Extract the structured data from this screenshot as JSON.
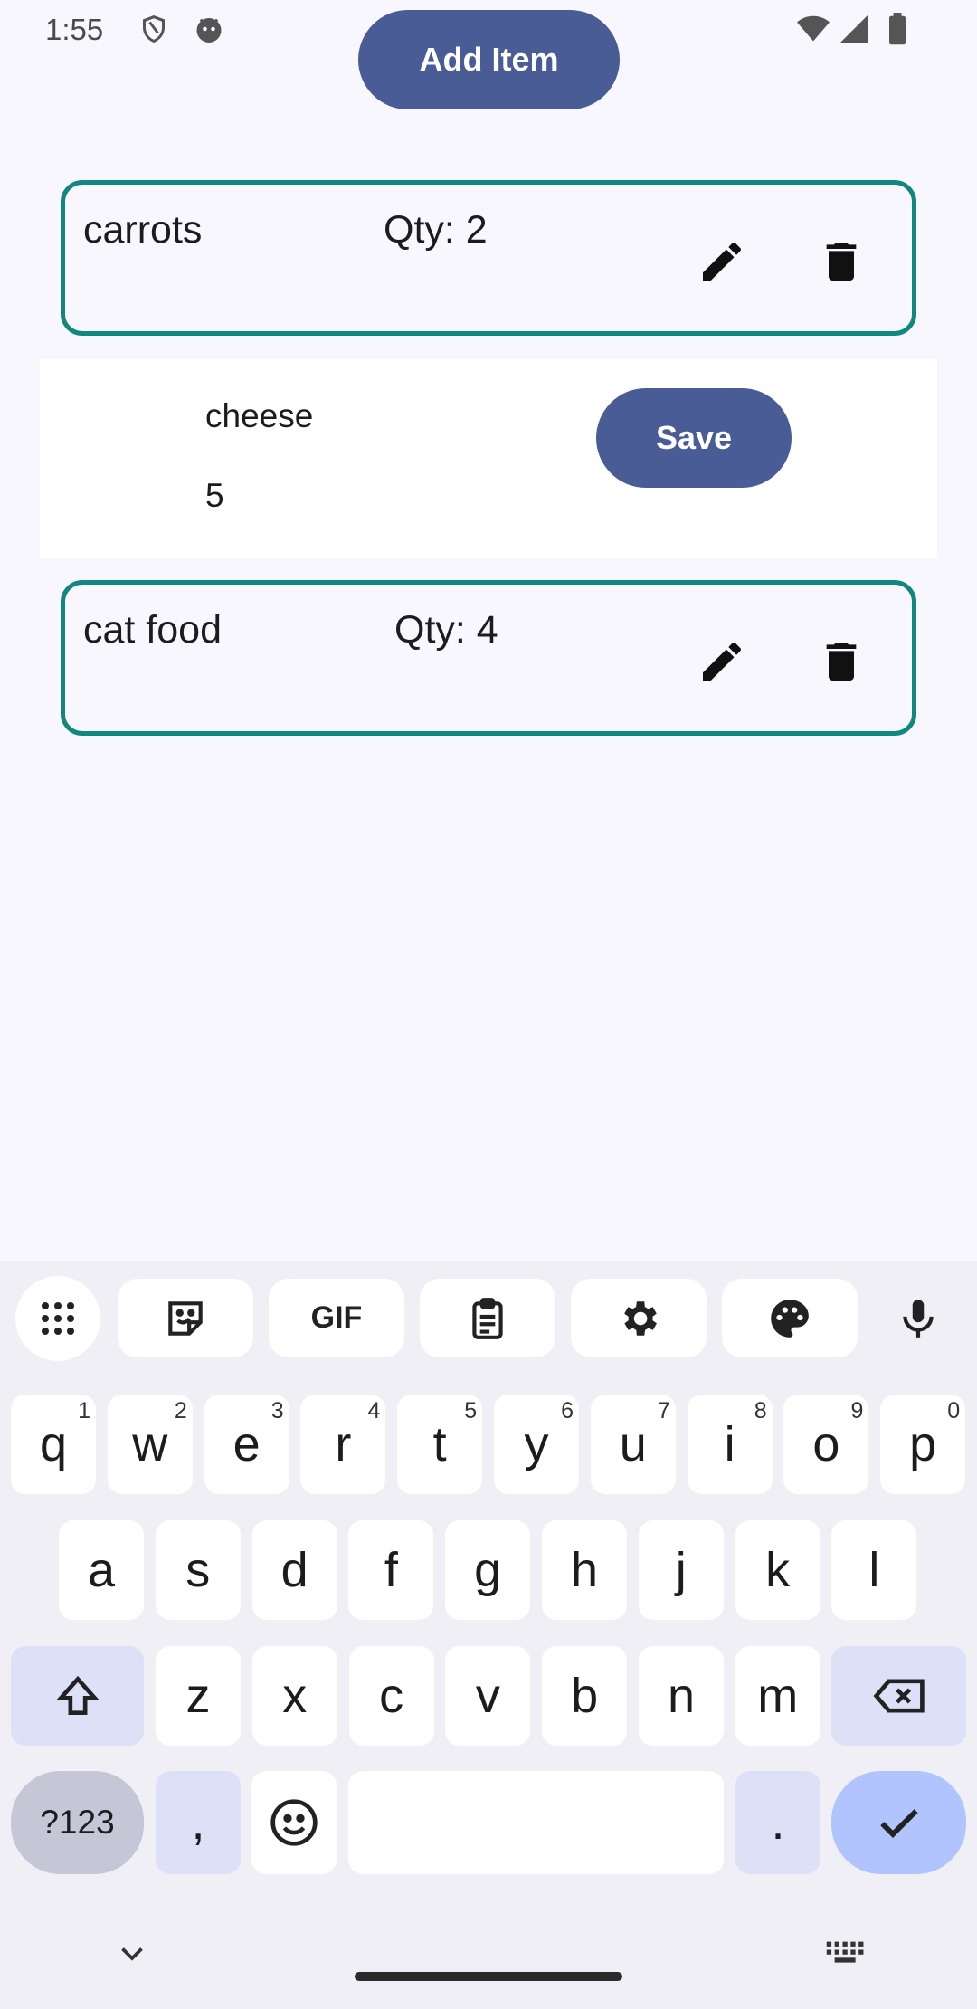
{
  "status": {
    "time": "1:55"
  },
  "header": {
    "add_label": "Add Item"
  },
  "items": [
    {
      "name": "carrots",
      "qty": "Qty: 2"
    },
    {
      "name": "cat food",
      "qty": "Qty: 4"
    }
  ],
  "edit": {
    "name_value": "cheese",
    "qty_value": "5",
    "save_label": "Save"
  },
  "keyboard": {
    "row1": [
      {
        "k": "q",
        "h": "1"
      },
      {
        "k": "w",
        "h": "2"
      },
      {
        "k": "e",
        "h": "3"
      },
      {
        "k": "r",
        "h": "4"
      },
      {
        "k": "t",
        "h": "5"
      },
      {
        "k": "y",
        "h": "6"
      },
      {
        "k": "u",
        "h": "7"
      },
      {
        "k": "i",
        "h": "8"
      },
      {
        "k": "o",
        "h": "9"
      },
      {
        "k": "p",
        "h": "0"
      }
    ],
    "row2": [
      "a",
      "s",
      "d",
      "f",
      "g",
      "h",
      "j",
      "k",
      "l"
    ],
    "row3": [
      "z",
      "x",
      "c",
      "v",
      "b",
      "n",
      "m"
    ],
    "sym_label": "?123",
    "comma": ",",
    "period": ".",
    "gif_label": "GIF"
  },
  "icons": {
    "status": [
      "shield-icon",
      "android-icon",
      "wifi-icon",
      "signal-icon",
      "battery-icon"
    ],
    "item_actions": [
      "edit-icon",
      "delete-icon"
    ],
    "toolbar": [
      "apps-grid-icon",
      "sticker-icon",
      "gif-icon",
      "clipboard-icon",
      "settings-icon",
      "palette-icon",
      "microphone-icon"
    ]
  },
  "colors": {
    "accent": "#4a5c95",
    "card_border": "#12877f",
    "enter_key": "#b1c4fd"
  }
}
